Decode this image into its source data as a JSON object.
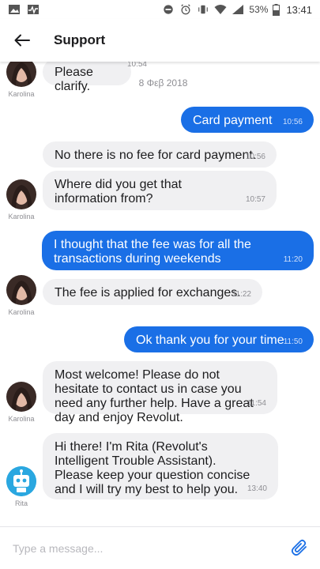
{
  "status_bar": {
    "battery": "53%",
    "time": "13:41",
    "icons": [
      "image-icon",
      "activity-icon",
      "dnd-icon",
      "alarm-icon",
      "vibrate-icon",
      "wifi-icon",
      "signal-icon",
      "battery-icon"
    ]
  },
  "header": {
    "title": "Support",
    "back_icon": "arrow-left-icon"
  },
  "chat": {
    "date_separator": "8 Φεβ 2018",
    "messages": [
      {
        "direction": "in",
        "sender": "Karolina",
        "text": "Please clarify.",
        "time": "10:54"
      },
      {
        "direction": "out",
        "text": "Card payment",
        "time": "10:56"
      },
      {
        "direction": "in",
        "text": "No there is no fee for card payment.",
        "time": "10:56"
      },
      {
        "direction": "in",
        "sender": "Karolina",
        "text": "Where did you get that information from?",
        "time": "10:57"
      },
      {
        "direction": "out",
        "text": "I thought that the fee was for all the transactions during weekends",
        "time": "11:20"
      },
      {
        "direction": "in",
        "sender": "Karolina",
        "text": "The fee is applied for exchanges.",
        "time": "11:22"
      },
      {
        "direction": "out",
        "text": "Ok thank you for your time",
        "time": "11:50"
      },
      {
        "direction": "in",
        "sender": "Karolina",
        "text": "Most welcome! Please do not hesitate to contact us in case you need any further help. Have a great day and enjoy Revolut.",
        "time": "11:54"
      },
      {
        "direction": "in",
        "sender": "Rita",
        "text": "Hi there! I'm Rita (Revolut's Intelligent Trouble Assistant). Please keep your question concise and I will try my best to help you.",
        "time": "13:40"
      }
    ]
  },
  "composer": {
    "placeholder": "Type a message...",
    "attach_icon": "paperclip-icon"
  },
  "colors": {
    "outgoing_bubble": "#1a6fe6",
    "incoming_bubble": "#f0f0f2",
    "accent": "#1a6fe6"
  }
}
